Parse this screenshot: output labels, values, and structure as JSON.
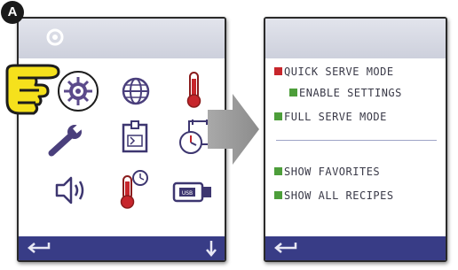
{
  "badge": {
    "label": "A"
  },
  "left_screen": {
    "icons": [
      "settings-gear-icon",
      "globe-icon",
      "thermometer-icon",
      "wrench-icon",
      "recipe-book-icon",
      "clock-calendar-icon",
      "speaker-icon",
      "temperature-timer-icon",
      "usb-drive-icon"
    ],
    "selected_icon": "settings-gear-icon",
    "footer": {
      "back_icon": "back-arrow-icon",
      "scroll_icon": "down-arrow-icon"
    }
  },
  "right_screen": {
    "options": [
      {
        "label": "QUICK SERVE MODE",
        "checkbox": "red"
      },
      {
        "label": "ENABLE SETTINGS",
        "checkbox": "green"
      },
      {
        "label": "FULL SERVE MODE",
        "checkbox": "green"
      },
      {
        "label": "SHOW FAVORITES",
        "checkbox": "green"
      },
      {
        "label": "SHOW ALL RECIPES",
        "checkbox": "green"
      }
    ],
    "footer": {
      "back_icon": "back-arrow-icon"
    }
  },
  "colors": {
    "footer": "#383c86",
    "checkbox_red": "#c7262c",
    "checkbox_green": "#4d9e3a",
    "text": "#3a3a48",
    "hand": "#f5e11c"
  }
}
